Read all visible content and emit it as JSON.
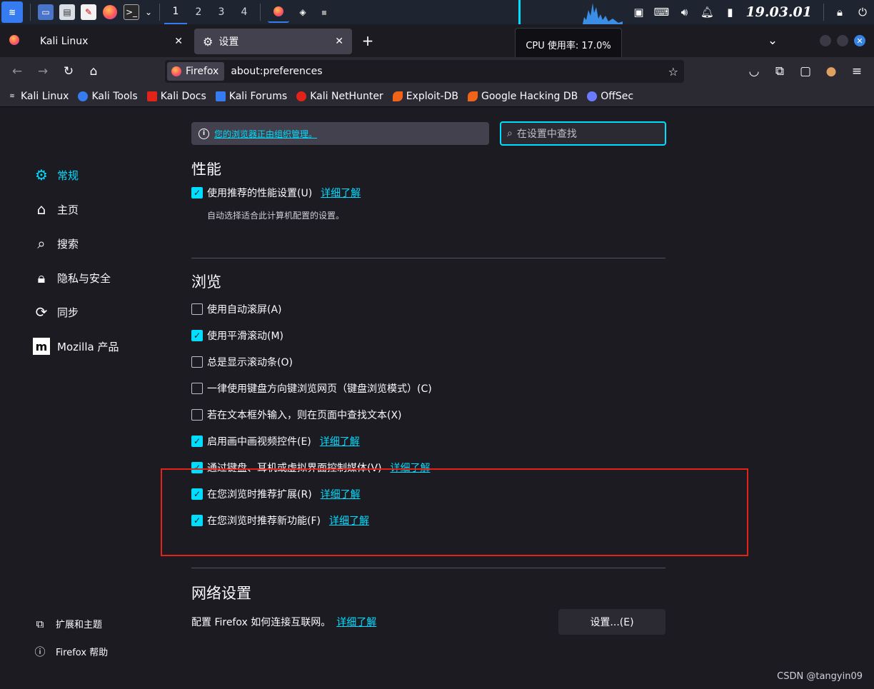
{
  "panel": {
    "workspaces": [
      "1",
      "2",
      "3",
      "4"
    ],
    "clock": "19.03.01"
  },
  "tooltip": "CPU 使用率: 17.0%",
  "tabs": [
    {
      "label": "Kali Linux"
    },
    {
      "label": "设置"
    }
  ],
  "urlbar": {
    "identity": "Firefox",
    "url": "about:preferences"
  },
  "bookmarks": [
    {
      "label": "Kali Linux",
      "color": "#e8e8e8"
    },
    {
      "label": "Kali Tools",
      "color": "#367bf0"
    },
    {
      "label": "Kali Docs",
      "color": "#e2231a"
    },
    {
      "label": "Kali Forums",
      "color": "#367bf0"
    },
    {
      "label": "Kali NetHunter",
      "color": "#e2231a"
    },
    {
      "label": "Exploit-DB",
      "color": "#f0641a"
    },
    {
      "label": "Google Hacking DB",
      "color": "#f0641a"
    },
    {
      "label": "OffSec",
      "color": "#6a7bff"
    }
  ],
  "policy_notice": "您的浏览器正由组织管理。",
  "search_placeholder": "在设置中查找",
  "sidebar": {
    "items": [
      {
        "label": "常规"
      },
      {
        "label": "主页"
      },
      {
        "label": "搜索"
      },
      {
        "label": "隐私与安全"
      },
      {
        "label": "同步"
      },
      {
        "label": "Mozilla 产品"
      }
    ],
    "footer": [
      {
        "label": "扩展和主题"
      },
      {
        "label": "Firefox 帮助"
      }
    ]
  },
  "performance": {
    "title": "性能",
    "option": "使用推荐的性能设置(U)",
    "learn_more": "详细了解",
    "hint": "自动选择适合此计算机配置的设置。"
  },
  "browsing": {
    "title": "浏览",
    "options": [
      {
        "label": "使用自动滚屏(A)",
        "checked": false,
        "learn_more": ""
      },
      {
        "label": "使用平滑滚动(M)",
        "checked": true,
        "learn_more": ""
      },
      {
        "label": "总是显示滚动条(O)",
        "checked": false,
        "learn_more": ""
      },
      {
        "label": "一律使用键盘方向键浏览网页（键盘浏览模式）(C)",
        "checked": false,
        "learn_more": ""
      },
      {
        "label": "若在文本框外输入，则在页面中查找文本(X)",
        "checked": false,
        "learn_more": ""
      },
      {
        "label": "启用画中画视频控件(E)",
        "checked": true,
        "learn_more": "详细了解"
      },
      {
        "label": "通过键盘、耳机或虚拟界面控制媒体(V)",
        "checked": true,
        "learn_more": "详细了解"
      },
      {
        "label": "在您浏览时推荐扩展(R)",
        "checked": true,
        "learn_more": "详细了解"
      },
      {
        "label": "在您浏览时推荐新功能(F)",
        "checked": true,
        "learn_more": "详细了解"
      }
    ]
  },
  "network": {
    "title": "网络设置",
    "description": "配置 Firefox 如何连接互联网。",
    "learn_more": "详细了解",
    "button": "设置...(E)"
  },
  "watermark": "CSDN @tangyin09"
}
